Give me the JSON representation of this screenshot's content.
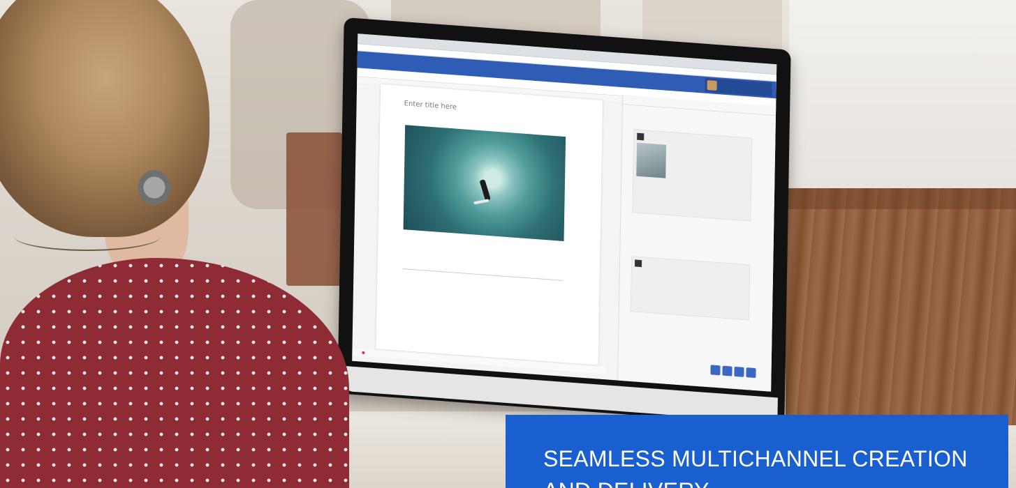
{
  "banner": {
    "heading": "SEAMLESS MULTICHANNEL CREATION AND DELIVERY",
    "background_color": "#1a5fd0"
  },
  "editor": {
    "title_placeholder": "Enter title here",
    "accent_color": "#2f5db5"
  }
}
